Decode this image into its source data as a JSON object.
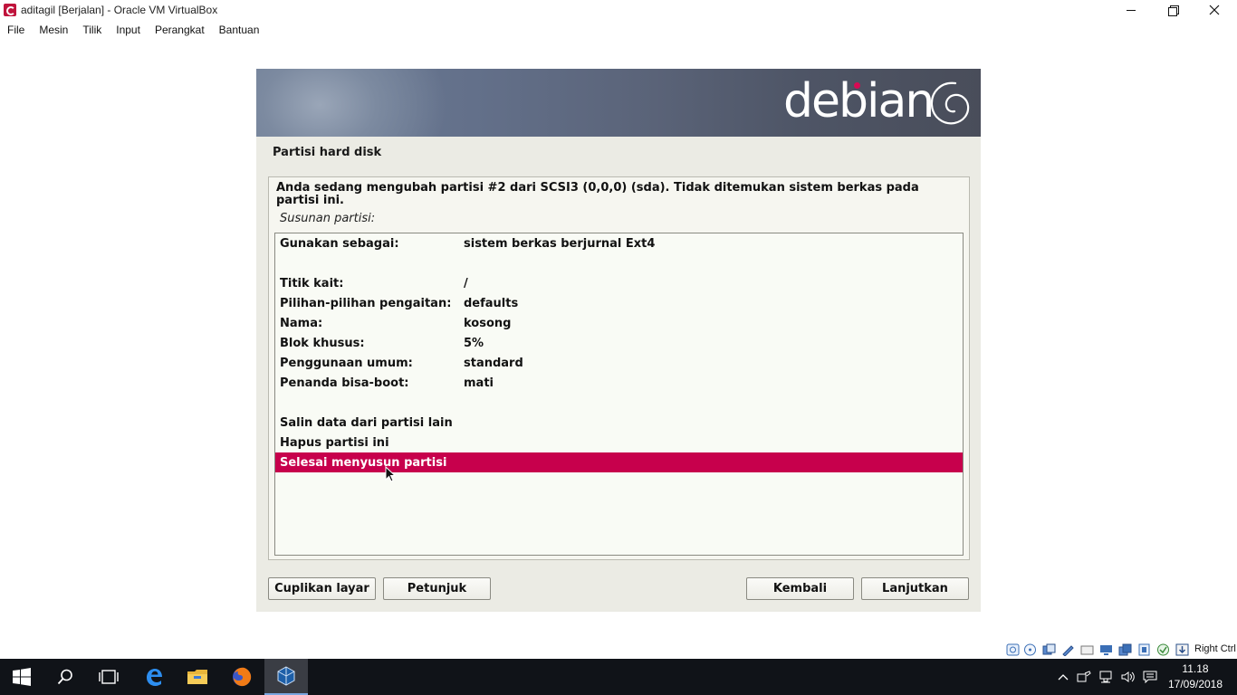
{
  "window": {
    "title": "aditagil [Berjalan] - Oracle VM VirtualBox",
    "menu": [
      "File",
      "Mesin",
      "Tilik",
      "Input",
      "Perangkat",
      "Bantuan"
    ]
  },
  "installer": {
    "brand": "debian",
    "section_title": "Partisi hard disk",
    "description": "Anda sedang mengubah partisi #2 dari SCSI3 (0,0,0) (sda). Tidak ditemukan sistem berkas pada partisi ini.",
    "layout_label": "Susunan partisi:",
    "settings": [
      {
        "key": "Gunakan sebagai:",
        "value": "sistem berkas berjurnal Ext4"
      },
      {
        "key": "Titik kait:",
        "value": "/"
      },
      {
        "key": "Pilihan-pilihan pengaitan:",
        "value": "defaults"
      },
      {
        "key": "Nama:",
        "value": "kosong"
      },
      {
        "key": "Blok khusus:",
        "value": "5%"
      },
      {
        "key": "Penggunaan umum:",
        "value": "standard"
      },
      {
        "key": "Penanda bisa-boot:",
        "value": "mati"
      }
    ],
    "actions": [
      {
        "label": "Salin data dari partisi lain",
        "selected": false
      },
      {
        "label": "Hapus partisi ini",
        "selected": false
      },
      {
        "label": "Selesai menyusun partisi",
        "selected": true
      }
    ],
    "buttons": {
      "screenshot": "Cuplikan layar",
      "help": "Petunjuk",
      "back": "Kembali",
      "continue": "Lanjutkan"
    },
    "accent_color": "#c7004c"
  },
  "vbox_status": {
    "host_key": "Right Ctrl",
    "icons": [
      "hard-disk-icon",
      "optical-drive-icon",
      "audio-icon",
      "network-icon",
      "usb-icon",
      "shared-folders-icon",
      "display-icon",
      "video-capture-icon",
      "virtualization-icon",
      "mouse-integration-icon",
      "keyboard-capture-icon"
    ]
  },
  "taskbar": {
    "apps": [
      "start-icon",
      "search-icon",
      "task-view-icon",
      "edge-icon",
      "file-explorer-icon",
      "firefox-icon",
      "virtualbox-icon"
    ],
    "time": "11.18",
    "date": "17/09/2018"
  }
}
